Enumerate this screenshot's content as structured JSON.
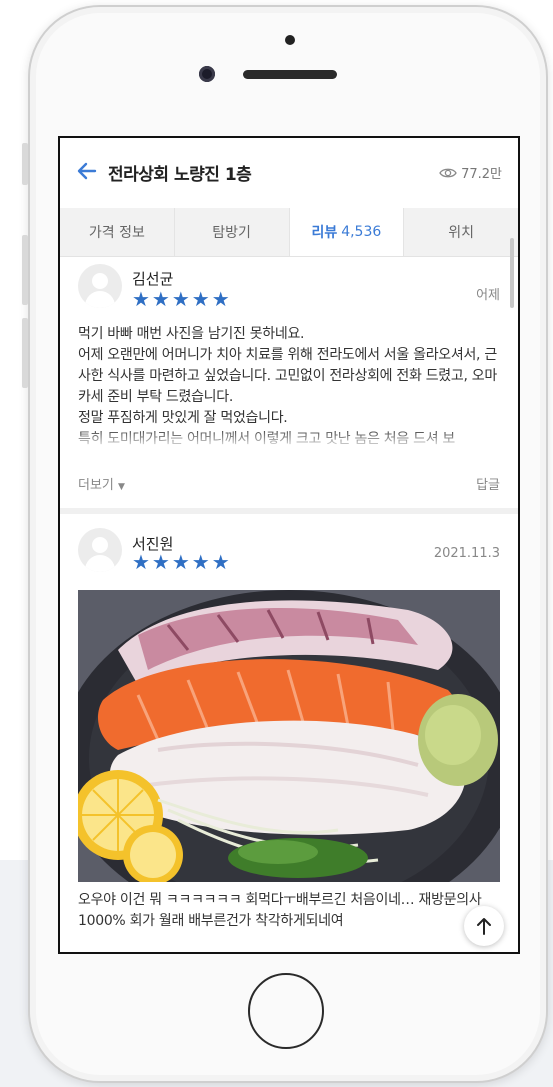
{
  "header": {
    "title": "전라상회 노량진 1층",
    "views": "77.2만"
  },
  "tabs": [
    {
      "label": "가격 정보"
    },
    {
      "label": "탐방기"
    },
    {
      "label": "리뷰",
      "count": "4,536"
    },
    {
      "label": "위치"
    }
  ],
  "reviews": [
    {
      "name": "김선균",
      "stars": "★★★★★",
      "date": "어제",
      "text": "먹기 바빠 매번 사진을 남기진 못하네요.\n어제 오랜만에 어머니가 치아 치료를 위해 전라도에서 서울 올라오셔서, 근사한 식사를 마련하고 싶었습니다. 고민없이 전라상회에 전화 드렸고, 오마카세 준비 부탁 드렸습니다.\n정말 푸짐하게 맛있게 잘 먹었습니다.\n특히 도미대가리는 어머니께서 이렇게 크고 맛난 놈은 처음 드셔 보",
      "more": "더보기",
      "reply": "답글"
    },
    {
      "name": "서진원",
      "stars": "★★★★★",
      "date": "2021.11.3",
      "text": "오우야 이건 뭐 ㅋㅋㅋㅋㅋㅋ 회먹다ㅜ배부르긴 처음이네… 재방문의사1000% 회가 월래 배부른건가 착각하게되네여"
    }
  ],
  "icons": {
    "back": "arrow-left-icon",
    "views": "eye-icon",
    "scroll_top": "arrow-up-icon"
  },
  "colors": {
    "accent": "#3b7bd6",
    "star": "#2f6fc4"
  }
}
